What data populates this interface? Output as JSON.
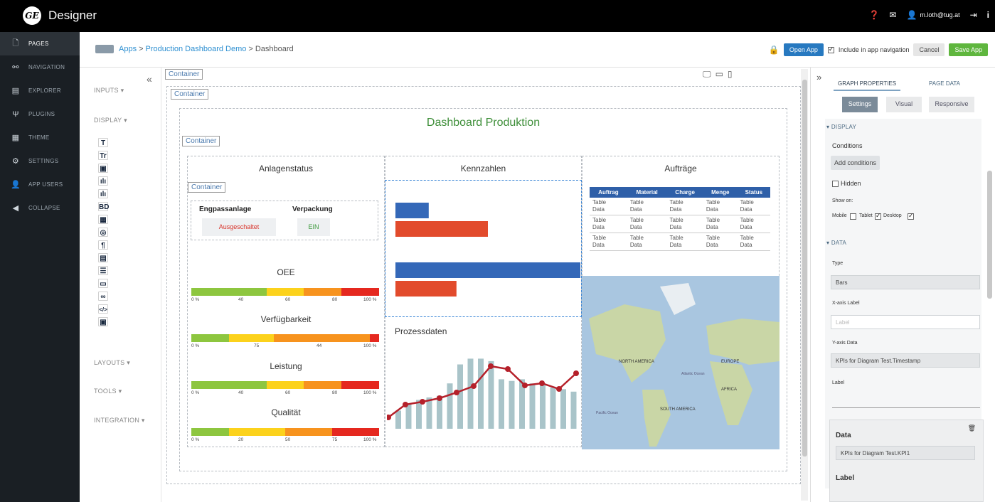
{
  "app": {
    "logo": "GE",
    "title": "Designer",
    "user": "m.loth@tug.at",
    "help_icon": "help-icon",
    "mail_icon": "mail-icon",
    "user_icon": "user-icon",
    "logout_icon": "logout-icon",
    "info_icon": "info-icon"
  },
  "sidebar": {
    "items": [
      {
        "label": "PAGES",
        "icon": "pages-icon",
        "active": true
      },
      {
        "label": "NAVIGATION",
        "icon": "navigation-icon"
      },
      {
        "label": "EXPLORER",
        "icon": "explorer-icon"
      },
      {
        "label": "PLUGINS",
        "icon": "plugins-icon"
      },
      {
        "label": "THEME",
        "icon": "theme-icon"
      },
      {
        "label": "SETTINGS",
        "icon": "settings-icon"
      },
      {
        "label": "APP USERS",
        "icon": "app-users-icon"
      },
      {
        "label": "COLLAPSE",
        "icon": "collapse-icon"
      }
    ]
  },
  "toolbar": {
    "bc_apps": "Apps",
    "bc_sep": ">",
    "bc_project": "Production Dashboard Demo",
    "bc_page": "Dashboard",
    "open_app": "Open App",
    "include_nav": "Include in app navigation",
    "cancel": "Cancel",
    "save_app": "Save App"
  },
  "palette": {
    "inputs": "INPUTS ▾",
    "display": "DISPLAY ▾",
    "layouts": "LAYOUTS ▾",
    "tools": "TOOLS ▾",
    "integration": "INTEGRATION ▾",
    "icons": [
      "T",
      "Tr",
      "▣",
      "ılı",
      "ılı",
      "BD",
      "▦",
      "◎",
      "¶",
      "▤",
      "☰",
      "▭",
      "∞",
      "</>",
      "▣"
    ]
  },
  "canvas": {
    "container": "Container",
    "dashboard_title": "Dashboard Produktion",
    "anlagenstatus": "Anlagenstatus",
    "kennzahlen": "Kennzahlen",
    "auftraege": "Aufträge",
    "engpass": "Engpassanlage",
    "verpackung": "Verpackung",
    "ausgeschaltet": "Ausgeschaltet",
    "ein": "EIN",
    "oee": "OEE",
    "verfuegbarkeit": "Verfügbarkeit",
    "leistung": "Leistung",
    "qualitaet": "Qualität",
    "prozessdaten": "Prozessdaten",
    "gauges": [
      {
        "ticks": [
          "0 %",
          "40",
          "60",
          "80",
          "100 %"
        ]
      },
      {
        "ticks": [
          "0 %",
          "75",
          "44",
          "100 %"
        ]
      },
      {
        "ticks": [
          "0 %",
          "40",
          "60",
          "80",
          "100 %"
        ]
      },
      {
        "ticks": [
          "0 %",
          "20",
          "50",
          "75",
          "100 %"
        ]
      }
    ],
    "table": {
      "headers": [
        "Auftrag",
        "Material",
        "Charge",
        "Menge",
        "Status"
      ],
      "cell": "Table Data",
      "rows": 3
    },
    "map_labels": {
      "na": "NORTH AMERICA",
      "eu": "EUROPE",
      "af": "AFRICA",
      "sa": "SOUTH AMERICA",
      "ao": "Atlantic Ocean",
      "po": "Pacific Ocean"
    }
  },
  "colors": {
    "blue": "#3468b8",
    "red": "#e24b2c",
    "green": "#8dc63f",
    "yellow": "#fcd21c",
    "orange": "#f7931e",
    "darkred": "#e5281f",
    "line": "#b5202a",
    "column": "#a9c4c9",
    "ocean": "#a9c6e0",
    "land": "#c9d6a6"
  },
  "kennzahlen_chart": {
    "type": "bar",
    "values": [
      0.18,
      0.5,
      1.0,
      0.33
    ]
  },
  "prozess_chart": {
    "type": "line",
    "line": [
      0.2,
      0.38,
      0.42,
      0.47,
      0.55,
      0.64,
      0.92,
      0.88,
      0.65,
      0.68,
      0.6,
      0.82
    ],
    "columns": [
      0.22,
      0.3,
      0.35,
      0.38,
      0.4,
      0.55,
      0.78,
      0.85,
      0.85,
      0.82,
      0.6,
      0.58,
      0.6,
      0.55,
      0.55,
      0.5,
      0.48,
      0.45
    ]
  },
  "props": {
    "tab_graph": "GRAPH PROPERTIES",
    "tab_page": "PAGE DATA",
    "seg": [
      "Settings",
      "Visual",
      "Responsive"
    ],
    "display": "▾ DISPLAY",
    "conditions": "Conditions",
    "add_conditions": "Add conditions",
    "hidden": "Hidden",
    "show_on": "Show on:",
    "mobile": "Mobile",
    "tablet": "Tablet",
    "desktop": "Desktop",
    "data": "▾ DATA",
    "type": "Type",
    "type_val": "Bars",
    "xlabel": "X-axis Label",
    "xlabel_ph": "Label",
    "ydata": "Y-axis Data",
    "ydata_val": "KPIs for Diagram Test.Timestamp",
    "label": "Label",
    "card_data": "Data",
    "card_data_val": "KPIs for Diagram Test.KPI1",
    "card_label": "Label"
  }
}
